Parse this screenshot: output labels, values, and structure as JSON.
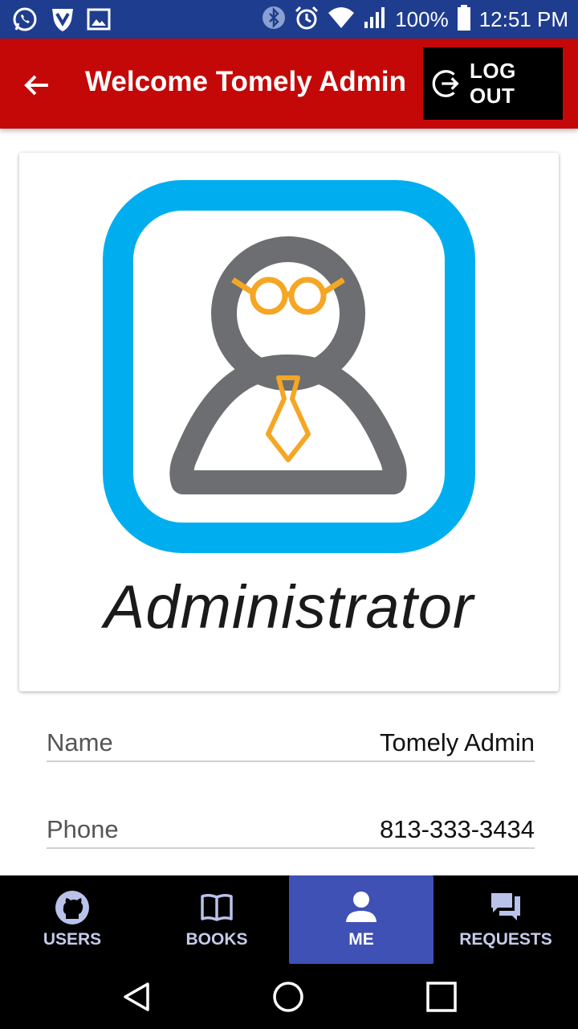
{
  "status_bar": {
    "battery": "100%",
    "time": "12:51 PM",
    "icons": [
      "whatsapp-icon",
      "shield-icon",
      "image-icon",
      "bluetooth-icon",
      "alarm-icon",
      "wifi-icon",
      "signal-icon",
      "battery-icon"
    ]
  },
  "appbar": {
    "title": "Welcome Tomely Admin",
    "logout_label": "LOG OUT",
    "background": "#c40808"
  },
  "profile": {
    "image_caption": "Administrator",
    "fields": [
      {
        "label": "Name",
        "value": "Tomely Admin"
      },
      {
        "label": "Phone",
        "value": "813-333-3434"
      }
    ]
  },
  "bottom_nav": {
    "items": [
      {
        "label": "USERS",
        "icon": "github-icon"
      },
      {
        "label": "BOOKS",
        "icon": "book-icon"
      },
      {
        "label": "ME",
        "icon": "person-icon"
      },
      {
        "label": "REQUESTS",
        "icon": "chat-icon"
      }
    ],
    "active": "ME",
    "active_color": "#3f51b5"
  },
  "colors": {
    "status_bar": "#1f3d8f",
    "logo_frame": "#00aeef",
    "logo_figure": "#6d6e71",
    "logo_accent": "#f5a623"
  }
}
